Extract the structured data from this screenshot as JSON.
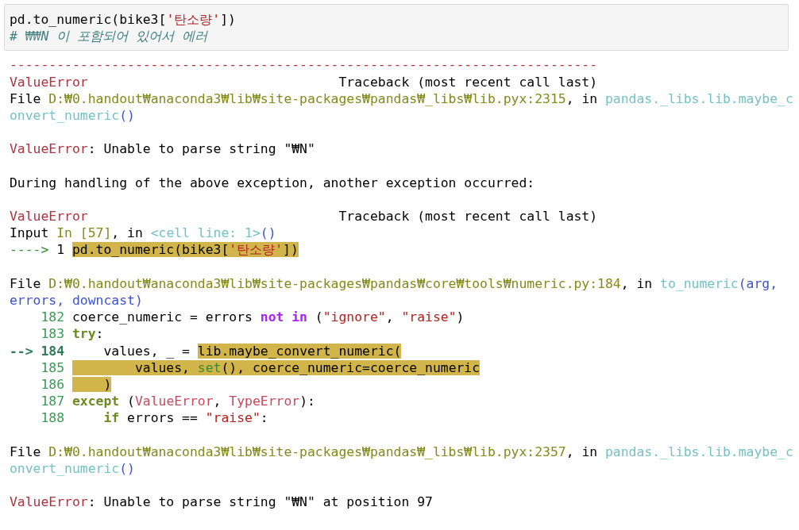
{
  "input_cell": {
    "lines": [
      {
        "segments": [
          {
            "text": "pd.to_numeric(bike3[",
            "kind": "plain",
            "highlighted": false
          },
          {
            "text": "'탄소량'",
            "kind": "string",
            "highlighted": false
          },
          {
            "text": "])",
            "kind": "plain",
            "highlighted": false
          }
        ]
      },
      {
        "segments": [
          {
            "text": "# ₩₩N 이 포함되어 있어서 에러",
            "kind": "comment",
            "highlighted": false
          }
        ]
      }
    ]
  },
  "output": {
    "blocks": [
      {
        "lines": [
          {
            "segments": [
              {
                "text": "---------------------------------------------------------------------------",
                "kind": "error",
                "highlighted": false
              }
            ]
          },
          {
            "segments": [
              {
                "text": "ValueError",
                "kind": "error",
                "highlighted": false
              },
              {
                "text": "                                Traceback (most recent call last)",
                "kind": "plain",
                "highlighted": false
              }
            ]
          },
          {
            "segments": [
              {
                "text": "File ",
                "kind": "plain",
                "highlighted": false
              },
              {
                "text": "D:₩0.handout₩anaconda3₩lib₩site-packages₩pandas₩_libs₩lib.pyx:2315",
                "kind": "path",
                "highlighted": false
              },
              {
                "text": ", in ",
                "kind": "plain",
                "highlighted": false
              },
              {
                "text": "pandas._libs.lib.maybe_c",
                "kind": "func",
                "highlighted": false
              }
            ]
          },
          {
            "segments": [
              {
                "text": "onvert_numeric",
                "kind": "func",
                "highlighted": false
              },
              {
                "text": "()",
                "kind": "paren",
                "highlighted": false
              }
            ]
          }
        ]
      },
      {
        "lines": [
          {
            "segments": [
              {
                "text": "ValueError",
                "kind": "error",
                "highlighted": false
              },
              {
                "text": ": Unable to parse string \"₩N\"",
                "kind": "plain",
                "highlighted": false
              }
            ]
          }
        ]
      },
      {
        "lines": [
          {
            "segments": [
              {
                "text": "During handling of the above exception, another exception occurred:",
                "kind": "plain",
                "highlighted": false
              }
            ]
          }
        ]
      },
      {
        "lines": [
          {
            "segments": [
              {
                "text": "ValueError",
                "kind": "error",
                "highlighted": false
              },
              {
                "text": "                                Traceback (most recent call last)",
                "kind": "plain",
                "highlighted": false
              }
            ]
          },
          {
            "segments": [
              {
                "text": "Input ",
                "kind": "plain",
                "highlighted": false
              },
              {
                "text": "In [57]",
                "kind": "path",
                "highlighted": false
              },
              {
                "text": ", in ",
                "kind": "plain",
                "highlighted": false
              },
              {
                "text": "<cell line: 1>",
                "kind": "func",
                "highlighted": false
              },
              {
                "text": "()",
                "kind": "paren",
                "highlighted": false
              }
            ]
          },
          {
            "segments": [
              {
                "text": "---->",
                "kind": "arrow",
                "highlighted": false
              },
              {
                "text": " 1 ",
                "kind": "plain",
                "highlighted": false
              },
              {
                "text": "pd.to_numeric(bike3[",
                "kind": "plain",
                "highlighted": true
              },
              {
                "text": "'탄소량'",
                "kind": "string",
                "highlighted": true
              },
              {
                "text": "])",
                "kind": "plain",
                "highlighted": true
              }
            ]
          }
        ]
      },
      {
        "lines": [
          {
            "segments": [
              {
                "text": "File ",
                "kind": "plain",
                "highlighted": false
              },
              {
                "text": "D:₩0.handout₩anaconda3₩lib₩site-packages₩pandas₩core₩tools₩numeric.py:184",
                "kind": "path",
                "highlighted": false
              },
              {
                "text": ", in ",
                "kind": "plain",
                "highlighted": false
              },
              {
                "text": "to_numeric",
                "kind": "func",
                "highlighted": false
              },
              {
                "text": "(arg,",
                "kind": "paren",
                "highlighted": false
              }
            ]
          },
          {
            "segments": [
              {
                "text": "errors, downcast)",
                "kind": "paren",
                "highlighted": false
              }
            ]
          },
          {
            "segments": [
              {
                "text": "    182",
                "kind": "lineno",
                "highlighted": false
              },
              {
                "text": " coerce_numeric = errors ",
                "kind": "plain",
                "highlighted": false
              },
              {
                "text": "not in",
                "kind": "keyword",
                "highlighted": false
              },
              {
                "text": " (",
                "kind": "plain",
                "highlighted": false
              },
              {
                "text": "\"ignore\"",
                "kind": "string",
                "highlighted": false
              },
              {
                "text": ", ",
                "kind": "plain",
                "highlighted": false
              },
              {
                "text": "\"raise\"",
                "kind": "string",
                "highlighted": false
              },
              {
                "text": ")",
                "kind": "plain",
                "highlighted": false
              }
            ]
          },
          {
            "segments": [
              {
                "text": "    183 ",
                "kind": "lineno",
                "highlighted": false
              },
              {
                "text": "try",
                "kind": "control",
                "highlighted": false
              },
              {
                "text": ":",
                "kind": "plain",
                "highlighted": false
              }
            ]
          },
          {
            "segments": [
              {
                "text": "--> 184",
                "kind": "current",
                "highlighted": false
              },
              {
                "text": "     values, _ = ",
                "kind": "plain",
                "highlighted": false
              },
              {
                "text": "lib.maybe_convert_numeric(",
                "kind": "plain",
                "highlighted": true
              }
            ]
          },
          {
            "segments": [
              {
                "text": "    185 ",
                "kind": "lineno",
                "highlighted": false
              },
              {
                "text": "        values, ",
                "kind": "plain",
                "highlighted": true
              },
              {
                "text": "set",
                "kind": "builtin",
                "highlighted": true
              },
              {
                "text": "(), coerce_numeric=coerce_numeric",
                "kind": "plain",
                "highlighted": true
              }
            ]
          },
          {
            "segments": [
              {
                "text": "    186 ",
                "kind": "lineno",
                "highlighted": false
              },
              {
                "text": "    )",
                "kind": "plain",
                "highlighted": true
              }
            ]
          },
          {
            "segments": [
              {
                "text": "    187 ",
                "kind": "lineno",
                "highlighted": false
              },
              {
                "text": "except",
                "kind": "control",
                "highlighted": false
              },
              {
                "text": " (",
                "kind": "plain",
                "highlighted": false
              },
              {
                "text": "ValueError",
                "kind": "exception",
                "highlighted": false
              },
              {
                "text": ", ",
                "kind": "plain",
                "highlighted": false
              },
              {
                "text": "TypeError",
                "kind": "exception",
                "highlighted": false
              },
              {
                "text": "):",
                "kind": "plain",
                "highlighted": false
              }
            ]
          },
          {
            "segments": [
              {
                "text": "    188     ",
                "kind": "lineno",
                "highlighted": false
              },
              {
                "text": "if",
                "kind": "control",
                "highlighted": false
              },
              {
                "text": " errors == ",
                "kind": "plain",
                "highlighted": false
              },
              {
                "text": "\"raise\"",
                "kind": "string",
                "highlighted": false
              },
              {
                "text": ":",
                "kind": "plain",
                "highlighted": false
              }
            ]
          }
        ]
      },
      {
        "lines": [
          {
            "segments": [
              {
                "text": "File ",
                "kind": "plain",
                "highlighted": false
              },
              {
                "text": "D:₩0.handout₩anaconda3₩lib₩site-packages₩pandas₩_libs₩lib.pyx:2357",
                "kind": "path",
                "highlighted": false
              },
              {
                "text": ", in ",
                "kind": "plain",
                "highlighted": false
              },
              {
                "text": "pandas._libs.lib.maybe_c",
                "kind": "func",
                "highlighted": false
              }
            ]
          },
          {
            "segments": [
              {
                "text": "onvert_numeric",
                "kind": "func",
                "highlighted": false
              },
              {
                "text": "()",
                "kind": "paren",
                "highlighted": false
              }
            ]
          }
        ]
      },
      {
        "lines": [
          {
            "segments": [
              {
                "text": "ValueError",
                "kind": "error",
                "highlighted": false
              },
              {
                "text": ": Unable to parse string \"₩N\" at position 97",
                "kind": "plain",
                "highlighted": false
              }
            ]
          }
        ]
      }
    ]
  }
}
